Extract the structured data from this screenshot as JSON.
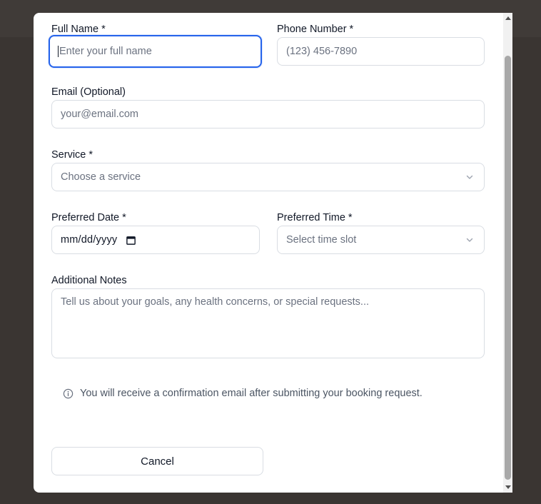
{
  "form": {
    "full_name": {
      "label": "Full Name *",
      "placeholder": "Enter your full name"
    },
    "phone": {
      "label": "Phone Number *",
      "placeholder": "(123) 456-7890"
    },
    "email": {
      "label": "Email (Optional)",
      "placeholder": "your@email.com"
    },
    "service": {
      "label": "Service *",
      "selected": "Choose a service"
    },
    "date": {
      "label": "Preferred Date *",
      "value": "mm/dd/yyyy"
    },
    "time": {
      "label": "Preferred Time *",
      "selected": "Select time slot"
    },
    "notes": {
      "label": "Additional Notes",
      "placeholder": "Tell us about your goals, any health concerns, or special requests..."
    }
  },
  "info_note": {
    "icon": "info-icon",
    "text": "You will receive a confirmation email after submitting your booking request."
  },
  "actions": {
    "cancel_label": "Cancel"
  },
  "icons": {
    "select_chevron": "chevron-down-icon",
    "date_picker": "calendar-icon",
    "scroll_up": "scroll-up-arrow-icon",
    "scroll_down": "scroll-down-arrow-icon"
  },
  "colors": {
    "focus_ring": "#2563eb",
    "backdrop": "#3a3532",
    "modal": "#ffffff",
    "border": "#d9dde3"
  }
}
